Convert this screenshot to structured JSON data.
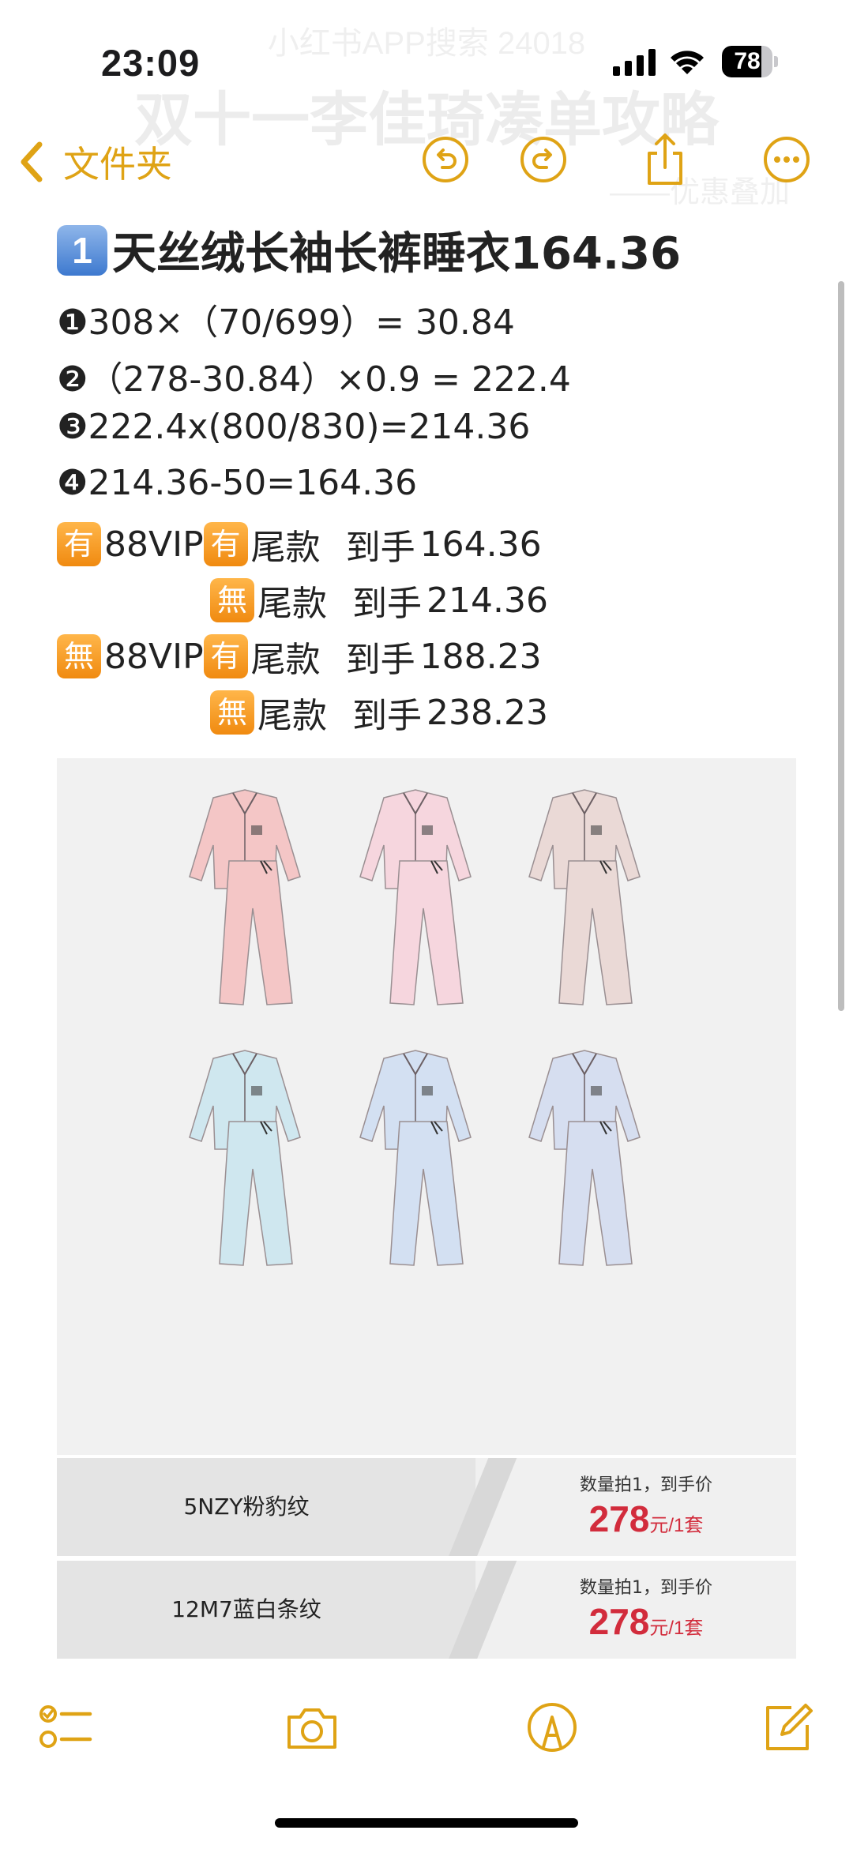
{
  "background_header": {
    "top_line": "小红书APP搜索 24018",
    "title": "双十一李佳琦凑单攻略",
    "subtitle": "——优惠叠加"
  },
  "status_bar": {
    "time": "23:09",
    "battery": "78",
    "battery_level": 0.78,
    "icons": [
      "cellular-signal-icon",
      "wifi-icon",
      "battery-icon"
    ]
  },
  "nav": {
    "back_label": "文件夹",
    "accent_color": "#dfa315",
    "icons": [
      "undo-icon",
      "redo-icon",
      "share-icon",
      "more-icon"
    ]
  },
  "note": {
    "title_keycap": "1",
    "title": "天丝绒长袖长裤睡衣164.36",
    "calc_lines": [
      "❶308×（70/699）= 30.84",
      "❷（278-30.84）×0.9 = 222.4",
      "❸222.4x(800/830)=214.36",
      "❹214.36-50=164.36"
    ],
    "summary": [
      {
        "badge1": "有",
        "vip": "88VIP",
        "badge2": "有",
        "tail": "尾款",
        "arrive": "到手",
        "price": "164.36"
      },
      {
        "badge2": "無",
        "tail": "尾款",
        "arrive": "到手",
        "price": "214.36"
      },
      {
        "badge1": "無",
        "vip": "88VIP",
        "badge2": "有",
        "tail": "尾款",
        "arrive": "到手",
        "price": "188.23"
      },
      {
        "badge2": "無",
        "tail": "尾款",
        "arrive": "到手",
        "price": "238.23"
      }
    ]
  },
  "product": {
    "pajama_colors": [
      "#f4c6c6",
      "#f6d6de",
      "#ead9d6",
      "#cfe7ef",
      "#d3e0f2",
      "#d6def0"
    ],
    "specs": [
      {
        "name": "5NZY粉豹纹",
        "hint": "数量拍1，到手价",
        "price": "278",
        "unit": "元/1套"
      },
      {
        "name": "12M7蓝白条纹",
        "hint": "数量拍1，到手价",
        "price": "278",
        "unit": "元/1套"
      }
    ]
  },
  "toolbar": {
    "icons": [
      "checklist-icon",
      "camera-icon",
      "markup-icon",
      "compose-icon"
    ]
  }
}
